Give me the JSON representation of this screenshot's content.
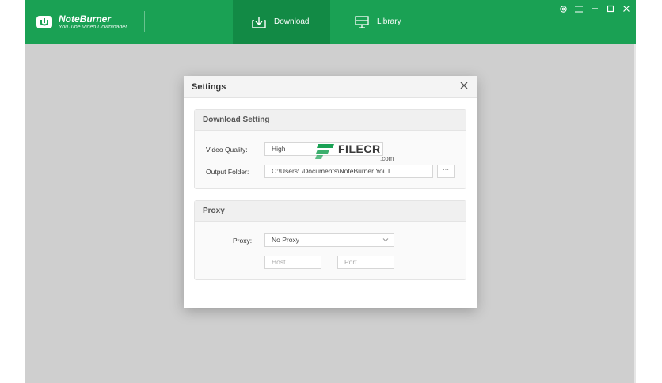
{
  "app": {
    "brand_name": "NoteBurner",
    "brand_sub": "YouTube Video Downloader",
    "accent_color": "#1aa154"
  },
  "nav": {
    "download_label": "Download",
    "library_label": "Library"
  },
  "window_controls": [
    "gear-icon",
    "menu-icon",
    "minimize-icon",
    "maximize-icon",
    "close-icon"
  ],
  "dialog": {
    "title": "Settings",
    "download_section": {
      "heading": "Download Setting",
      "video_quality_label": "Video Quality:",
      "video_quality_value": "High",
      "output_folder_label": "Output Folder:",
      "output_folder_value": "C:\\Users\\         \\Documents\\NoteBurner YouT",
      "browse_label": "···"
    },
    "proxy_section": {
      "heading": "Proxy",
      "proxy_label": "Proxy:",
      "proxy_value": "No Proxy",
      "host_placeholder": "Host",
      "port_placeholder": "Port"
    }
  },
  "watermark": {
    "text": "FILECR",
    "sub": ".com"
  }
}
